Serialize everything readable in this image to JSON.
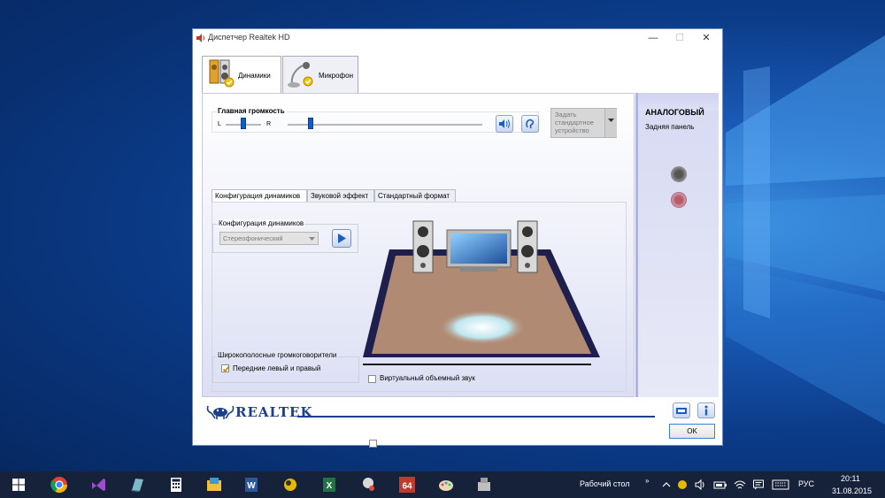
{
  "window": {
    "title": "Диспетчер Realtek HD",
    "min_glyph": "—",
    "max_glyph": "☐",
    "close_glyph": "✕"
  },
  "tabs": {
    "speakers": "Динамики",
    "microphone": "Микрофон"
  },
  "volume": {
    "label": "Главная громкость",
    "left": "L",
    "right": "R",
    "balance_fraction": 0.5,
    "master_level_fraction": 0.12
  },
  "default_device": {
    "line1": "Задать",
    "line2": "стандартное",
    "line3": "устройство"
  },
  "subtabs": {
    "config": "Конфигурация динамиков",
    "effect": "Звуковой эффект",
    "format": "Стандартный формат"
  },
  "speaker_config": {
    "group_label": "Конфигурация динамиков",
    "selected": "Стереофонический"
  },
  "fullrange": {
    "group_label": "Широкополосные громкоговорители",
    "front_label": "Передние левый и правый",
    "front_checked": true
  },
  "virtual_surround": {
    "label": "Виртуальный объемный звук",
    "checked": false
  },
  "right_panel": {
    "title": "АНАЛОГОВЫЙ",
    "subtitle": "Задняя панель"
  },
  "brand": {
    "name": "REALTEK"
  },
  "ok_label": "OK",
  "taskbar": {
    "desktop_label": "Рабочий стол",
    "lang": "РУС",
    "time": "20:11",
    "date": "31.08.2015",
    "excel_icon_text": "X",
    "word_icon_text": "W",
    "app64_text": "64"
  },
  "colors": {
    "accent": "#0e5ec9",
    "floor": "#b08a72",
    "panel_edge": "#b0b5e0",
    "taskbar": "#16223a"
  }
}
